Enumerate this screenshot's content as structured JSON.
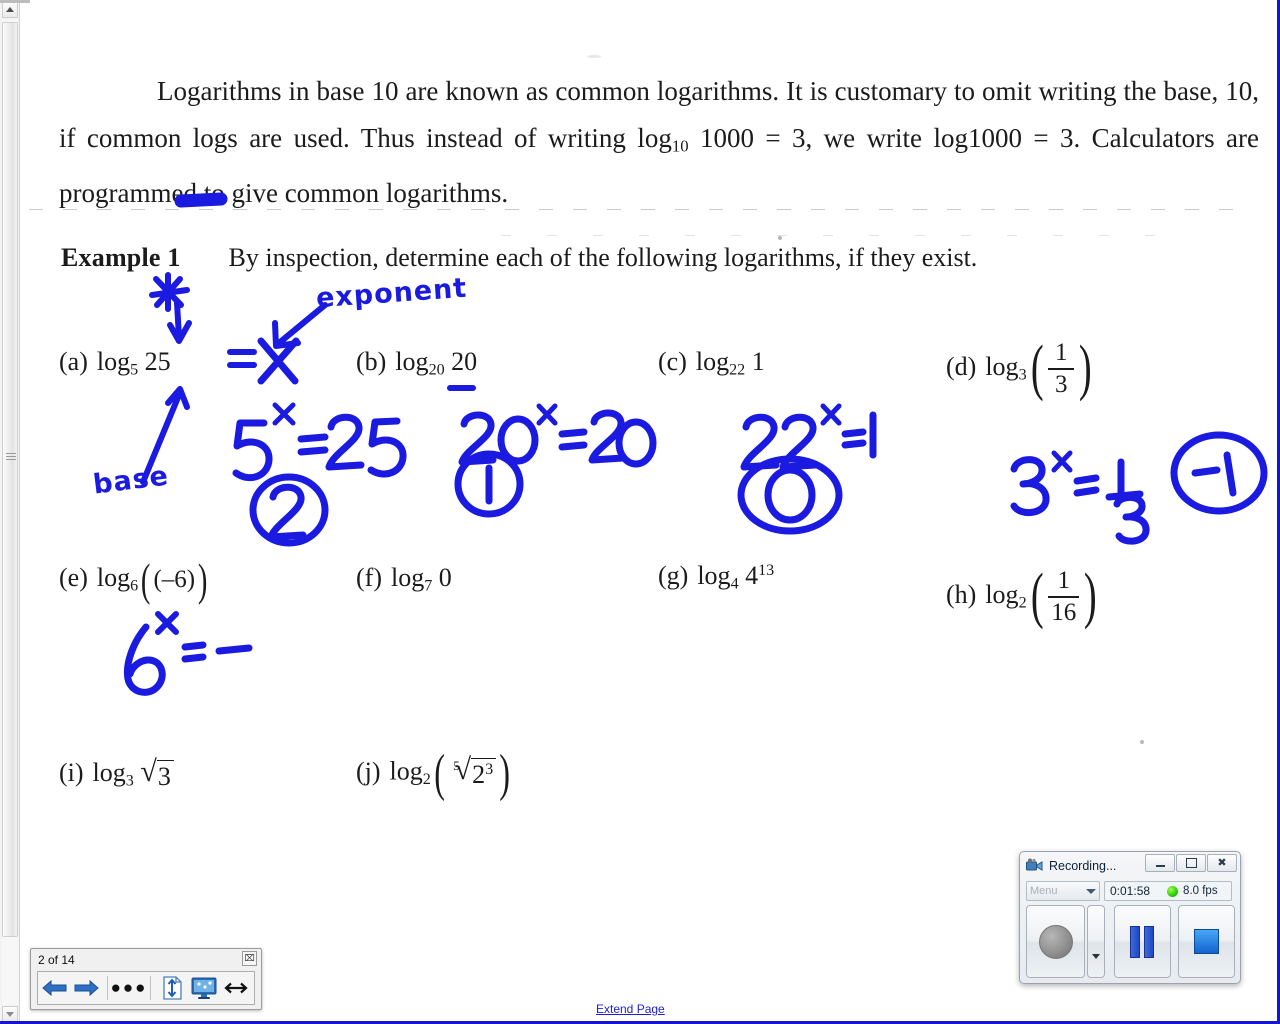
{
  "document": {
    "paragraph": {
      "line1": "Logarithms in base 10 are known as common logarithms.  It is customary to omit",
      "line2_a": "writing the base, 10, if common logs are used.  Thus instead of writing",
      "line2_log": "log",
      "line2_sub": "10",
      "line2_b": "1000 = 3",
      "line2_c": ", we",
      "line3_a": "write",
      "line3_log": "log",
      "line3_b": "1000 = 3",
      "line3_c": ".  Calculators are programmed to give common logarithms."
    },
    "example": {
      "heading": "Example 1",
      "instruction": "By inspection, determine each of the following logarithms, if they exist."
    },
    "problems": [
      {
        "label": "(a)",
        "log": "log",
        "base": "5",
        "arg": "25"
      },
      {
        "label": "(b)",
        "log": "log",
        "base": "20",
        "arg": "20"
      },
      {
        "label": "(c)",
        "log": "log",
        "base": "22",
        "arg": "1"
      },
      {
        "label": "(d)",
        "log": "log",
        "base": "3",
        "num": "1",
        "den": "3"
      },
      {
        "label": "(e)",
        "log": "log",
        "base": "6",
        "arg": "(–6)"
      },
      {
        "label": "(f)",
        "log": "log",
        "base": "7",
        "arg": "0"
      },
      {
        "label": "(g)",
        "log": "log",
        "base": "4",
        "arg": "4",
        "exp": "13"
      },
      {
        "label": "(h)",
        "log": "log",
        "base": "2",
        "num": "1",
        "den": "16"
      },
      {
        "label": "(i)",
        "log": "log",
        "base": "3",
        "radicand": "3"
      },
      {
        "label": "(j)",
        "log": "log",
        "base": "2",
        "root_index": "5",
        "radicand": "2",
        "radicand_exp": "3"
      }
    ]
  },
  "annotations": {
    "ink_color": "#1a1ae0",
    "star_mark": "✻",
    "exponent_label": "exponent",
    "base_label": "base",
    "a_equals_x": "X",
    "a_work": "5ˣ = 25",
    "a_answer": "2",
    "b_work": "20ˣ = 20",
    "b_answer": "1",
    "c_work": "22ˣ = 1",
    "c_answer": "0",
    "d_work": "3ˣ = 1/3",
    "d_answer": "-1",
    "e_work": "6ˣ = –"
  },
  "page_nav": {
    "counter": "2 of 14",
    "close_glyph": "⌧",
    "back_icon": "arrow-left-icon",
    "forward_icon": "arrow-right-icon",
    "more_icon": "ellipsis-icon",
    "fit_page_icon": "fit-page-icon",
    "presentation_icon": "monitor-icon",
    "fit_width_icon": "fit-width-icon"
  },
  "extend_page": {
    "label": "Extend Page"
  },
  "recorder": {
    "title": "Recording...",
    "app_icon": "camcorder-icon",
    "minimize_glyph": "–",
    "maximize_glyph": "□",
    "close_glyph": "✖",
    "menu_label": "Menu",
    "elapsed_time": "0:01:58",
    "status_color": "#23c703",
    "fps": "8.0 fps",
    "record_button": "record-button",
    "record_dropdown": "record-options-dropdown",
    "pause_button": "pause-button",
    "stop_button": "stop-button"
  },
  "scrollbar": {
    "up_arrow": "scroll-up-arrow",
    "down_arrow": "scroll-down-arrow",
    "thumb": "scroll-thumb"
  }
}
